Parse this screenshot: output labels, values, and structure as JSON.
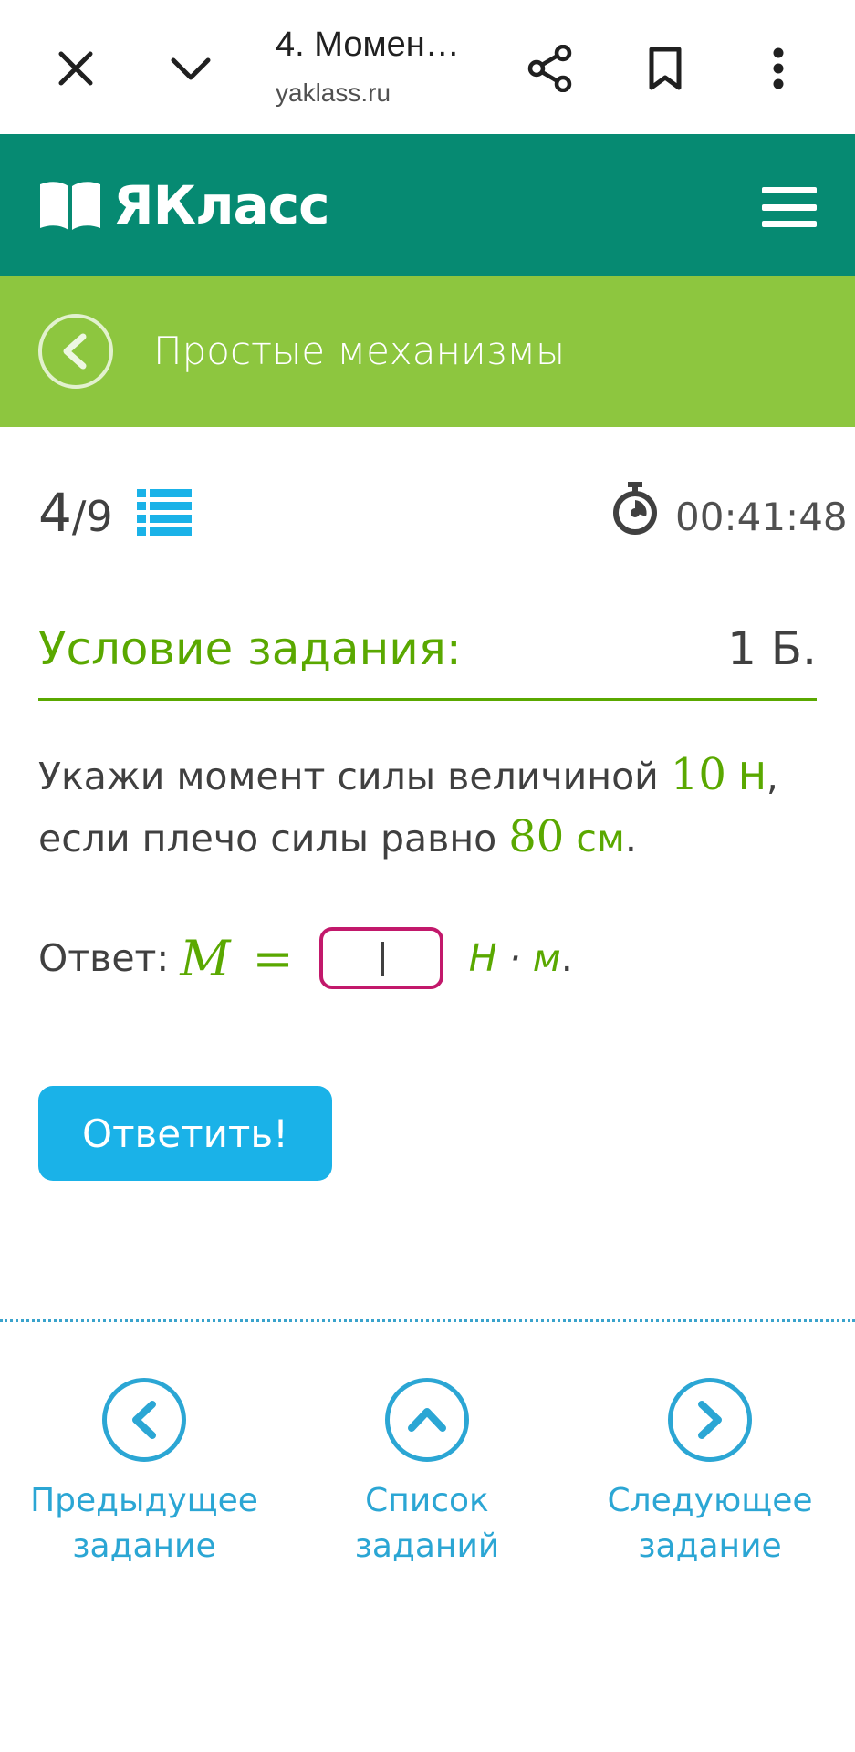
{
  "browser": {
    "tab_title": "4. Момен…",
    "url": "yaklass.ru",
    "icons": [
      "close-icon",
      "chevron-down-icon",
      "share-icon",
      "bookmark-icon",
      "more-vert-icon"
    ]
  },
  "header": {
    "logo_text": "ЯКласс",
    "colors": {
      "header_bg": "#068a72",
      "topic_bg": "#8dc63f",
      "accent_green": "#5aa800",
      "accent_blue": "#1ab2e8"
    }
  },
  "topic": {
    "title": "Простые механизмы"
  },
  "progress": {
    "current": "4",
    "total": "/9",
    "timer": "00:41:48"
  },
  "condition": {
    "title": "Условие задания:",
    "points": "1 Б."
  },
  "task": {
    "text_1": "Укажи момент силы величиной ",
    "force_value": "10",
    "force_unit": " Н",
    "text_2": ", если плечо силы равно ",
    "arm_value": "80",
    "arm_unit": " см",
    "text_3": "."
  },
  "answer": {
    "label": "Ответ:",
    "variable": "M",
    "equals": "=",
    "value": "",
    "unit_1": "Н",
    "unit_dot": " · ",
    "unit_2": "м",
    "period": "."
  },
  "submit_label": "Ответить!",
  "nav": {
    "prev": {
      "line1": "Предыдущее",
      "line2": "задание"
    },
    "list": {
      "line1": "Список",
      "line2": "заданий"
    },
    "next": {
      "line1": "Следующее",
      "line2": "задание"
    }
  }
}
